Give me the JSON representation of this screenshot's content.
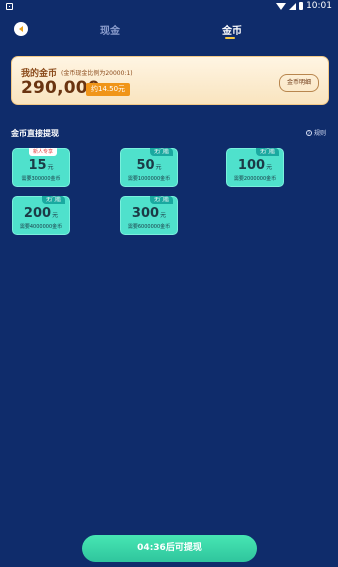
{
  "status_bar": {
    "time": "10:01"
  },
  "header": {
    "tabs": [
      {
        "label": "现金"
      },
      {
        "label": "金币"
      }
    ]
  },
  "coin_card": {
    "title": "我的金币",
    "ratio_note": "(金币现金比例为20000:1)",
    "amount": "290,000",
    "equivalent": "约14.50元",
    "detail_button": "金币明细"
  },
  "section": {
    "title": "金币直接提现",
    "rules_label": "规则"
  },
  "withdraw_options": [
    {
      "badge": "新人专享",
      "amount": "15",
      "unit": "元",
      "requirement": "需要300000金币"
    },
    {
      "badge": "无门槛",
      "amount": "50",
      "unit": "元",
      "requirement": "需要1000000金币"
    },
    {
      "badge": "无门槛",
      "amount": "100",
      "unit": "元",
      "requirement": "需要2000000金币"
    },
    {
      "badge": "无门槛",
      "amount": "200",
      "unit": "元",
      "requirement": "需要4000000金币"
    },
    {
      "badge": "无门槛",
      "amount": "300",
      "unit": "元",
      "requirement": "需要6000000金币"
    }
  ],
  "bottom_button": {
    "label": "04:36后可提现"
  }
}
